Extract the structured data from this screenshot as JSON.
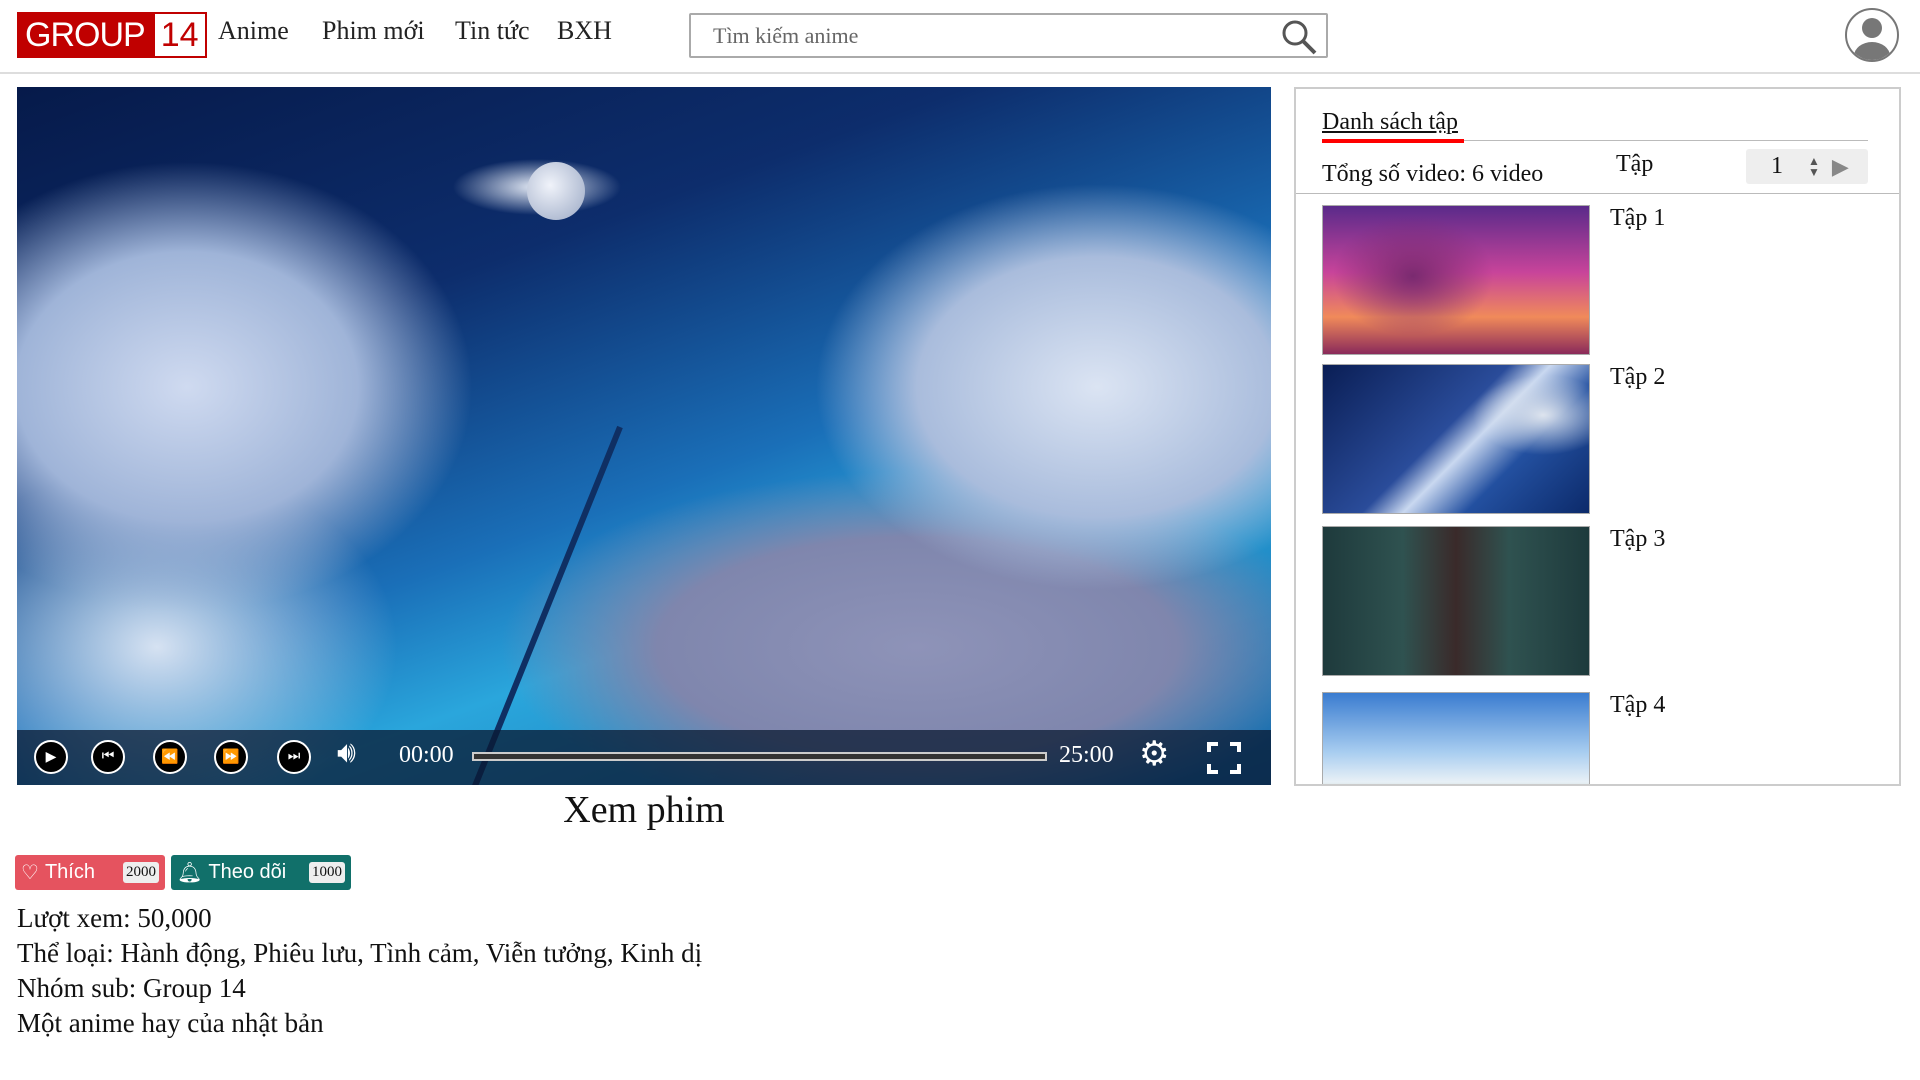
{
  "header": {
    "logo_text": "GROUP",
    "logo_number": "14",
    "nav": [
      "Anime",
      "Phim mới",
      "Tin tức",
      "BXH"
    ],
    "search_placeholder": "Tìm kiếm anime"
  },
  "player": {
    "current_time": "00:00",
    "duration": "25:00",
    "progress": 0
  },
  "page_title": "Xem phim",
  "actions": {
    "like_label": "Thích",
    "like_count": "2000",
    "follow_label": "Theo dõi",
    "follow_count": "1000"
  },
  "info": {
    "views": "Lượt xem: 50,000",
    "genres": "Thể loại: Hành động, Phiêu lưu, Tình cảm, Viễn tưởng, Kinh dị",
    "sub_group": "Nhóm sub: Group 14",
    "description": "Một anime hay của nhật bản"
  },
  "episodes": {
    "tab_label": "Danh sách tập",
    "total": "Tổng số video: 6 video",
    "selector_label": "Tập",
    "selector_value": "1",
    "items": [
      {
        "label": "Tập 1"
      },
      {
        "label": "Tập 2"
      },
      {
        "label": "Tập 3"
      },
      {
        "label": "Tập 4"
      }
    ]
  },
  "colors": {
    "brand": "#c00000",
    "like": "#e5535f",
    "follow": "#11706a",
    "tab_underline": "#ff0000"
  }
}
